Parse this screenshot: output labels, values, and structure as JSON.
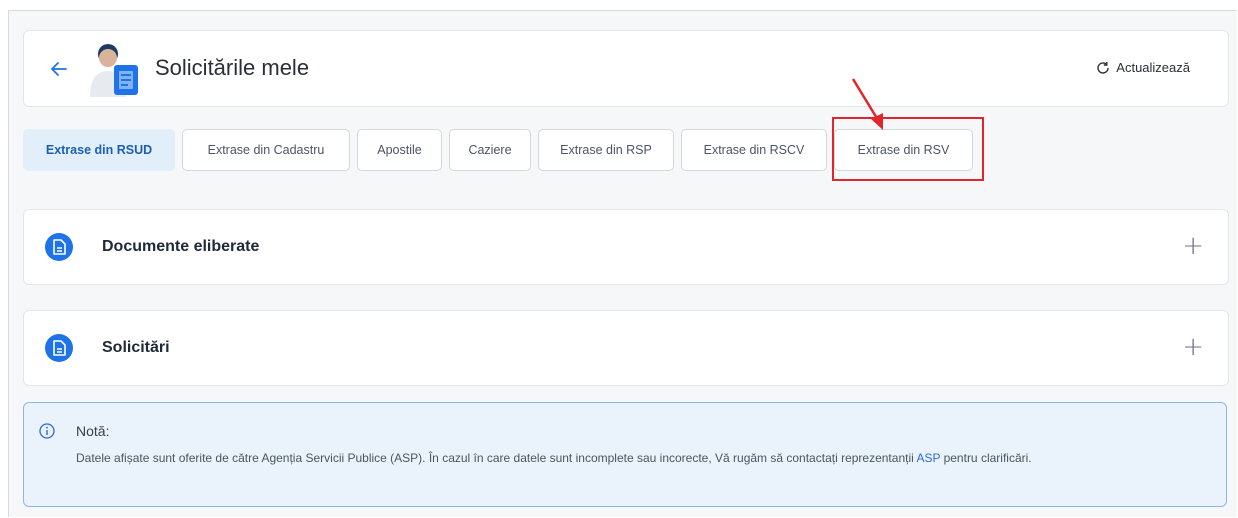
{
  "header": {
    "title": "Solicitările mele",
    "refresh_label": "Actualizează"
  },
  "tabs": [
    {
      "label": "Extrase din RSUD",
      "active": true
    },
    {
      "label": "Extrase din Cadastru",
      "active": false
    },
    {
      "label": "Apostile",
      "active": false
    },
    {
      "label": "Caziere",
      "active": false
    },
    {
      "label": "Extrase din RSP",
      "active": false
    },
    {
      "label": "Extrase din RSCV",
      "active": false
    },
    {
      "label": "Extrase din RSV",
      "active": false
    }
  ],
  "accordions": [
    {
      "title": "Documente eliberate"
    },
    {
      "title": "Solicitări"
    }
  ],
  "note": {
    "title": "Notă:",
    "text_before": "Datele afișate sunt oferite de către Agenția Servicii Publice (ASP). În cazul în care datele sunt incomplete sau incorecte, Vă rugăm să contactați reprezentanții ",
    "link": "ASP",
    "text_after": " pentru clarificări."
  },
  "colors": {
    "accent": "#1a5fb4",
    "icon_blue": "#1e73e8",
    "highlight_red": "#e0262a"
  },
  "icons": [
    "arrow-left-icon",
    "user-document-icon",
    "refresh-icon",
    "document-icon",
    "plus-icon",
    "info-icon"
  ]
}
